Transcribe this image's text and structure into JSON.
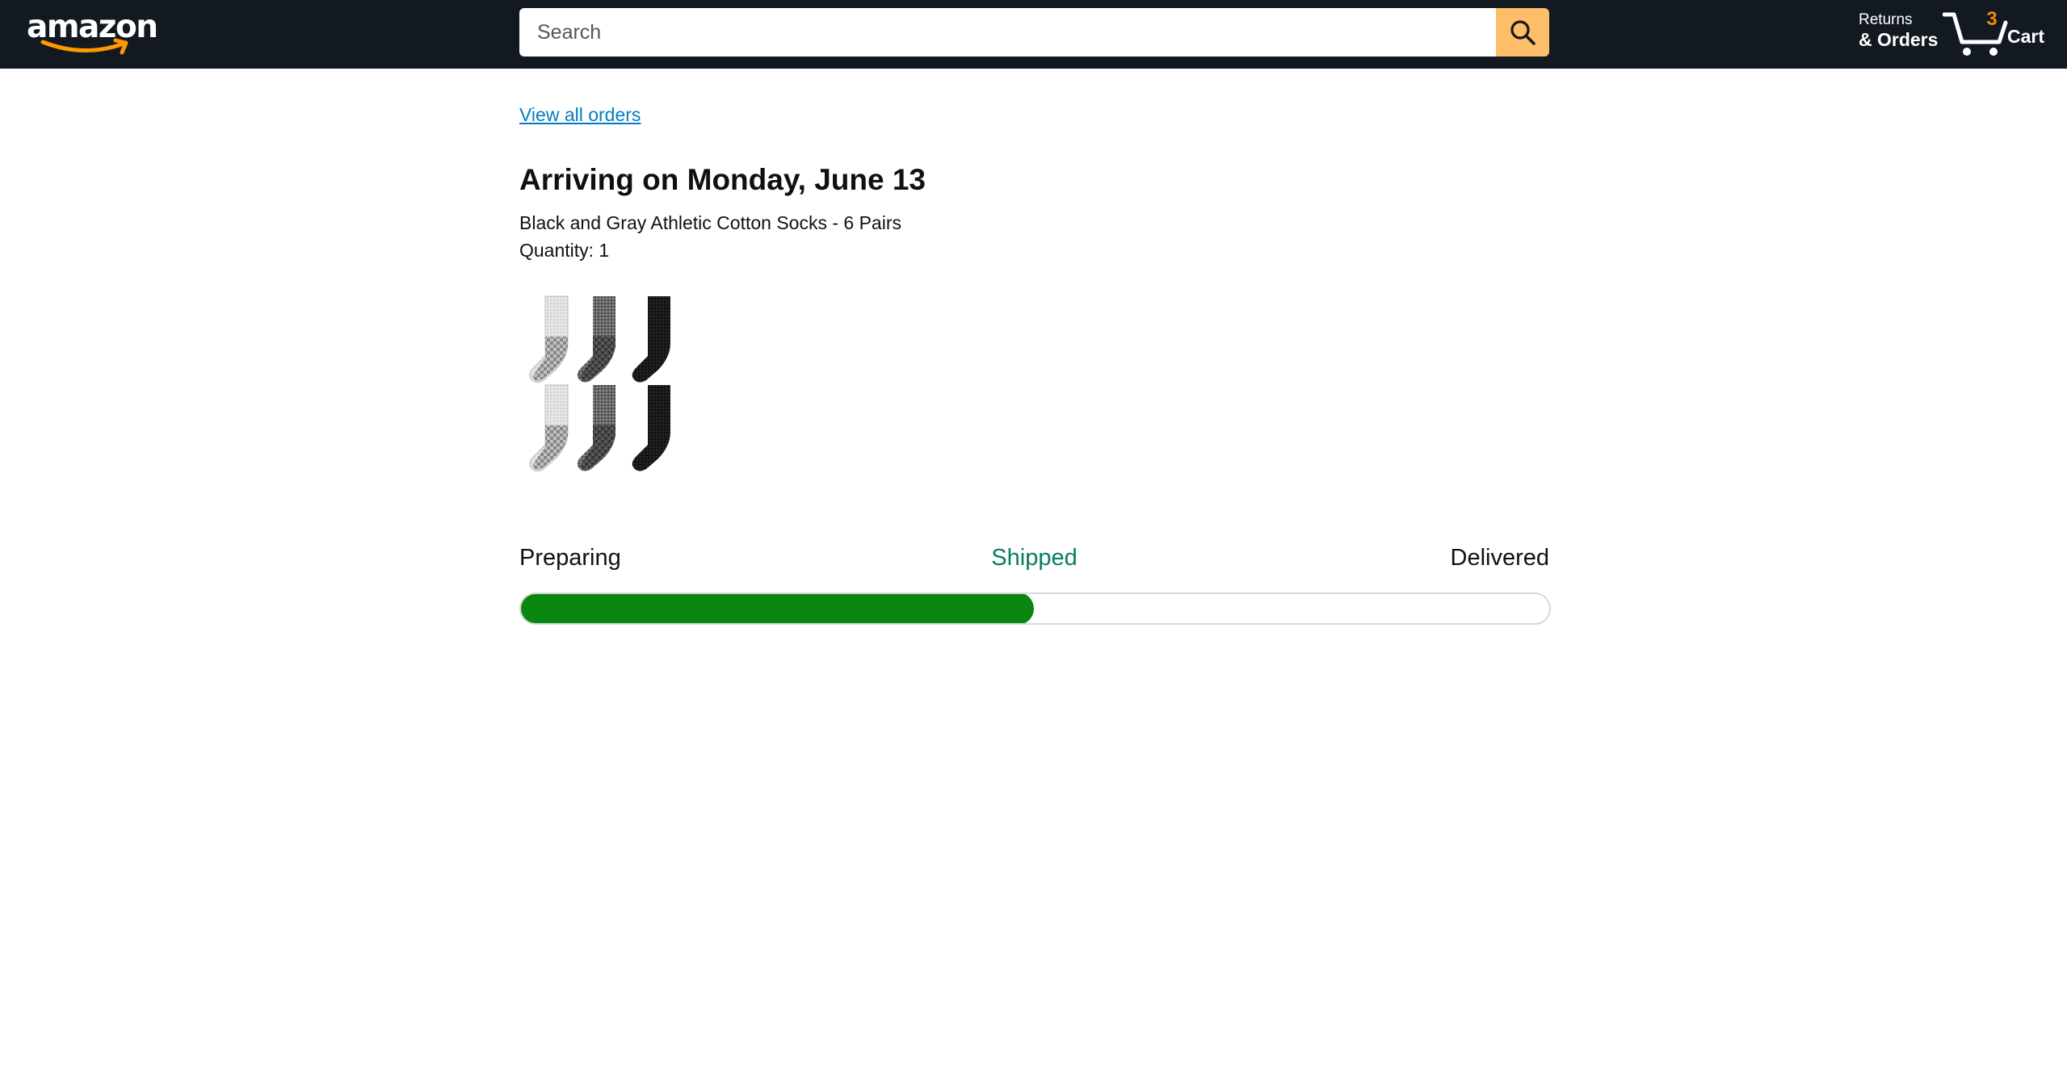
{
  "header": {
    "logo_text": "amazon",
    "search": {
      "placeholder": "Search",
      "value": ""
    },
    "returns": {
      "line1": "Returns",
      "line2": "& Orders"
    },
    "cart": {
      "count": "3",
      "label": "Cart"
    }
  },
  "main": {
    "view_all_orders": "View all orders",
    "arriving": "Arriving on Monday, June 13",
    "product_name": "Black and Gray Athletic Cotton Socks - 6 Pairs",
    "quantity": "Quantity: 1",
    "tracking": {
      "steps": [
        "Preparing",
        "Shipped",
        "Delivered"
      ],
      "current_step": "Shipped",
      "progress_percent": 50
    }
  },
  "colors": {
    "header_bg": "#131921",
    "search_button": "#febd69",
    "link": "#017cc3",
    "cart_count": "#f08804",
    "shipped_text": "#067d62",
    "progress_fill": "#0a8710"
  },
  "icons": {
    "search": "search-icon",
    "cart": "cart-icon",
    "logo_smile": "amazon-smile-icon"
  }
}
